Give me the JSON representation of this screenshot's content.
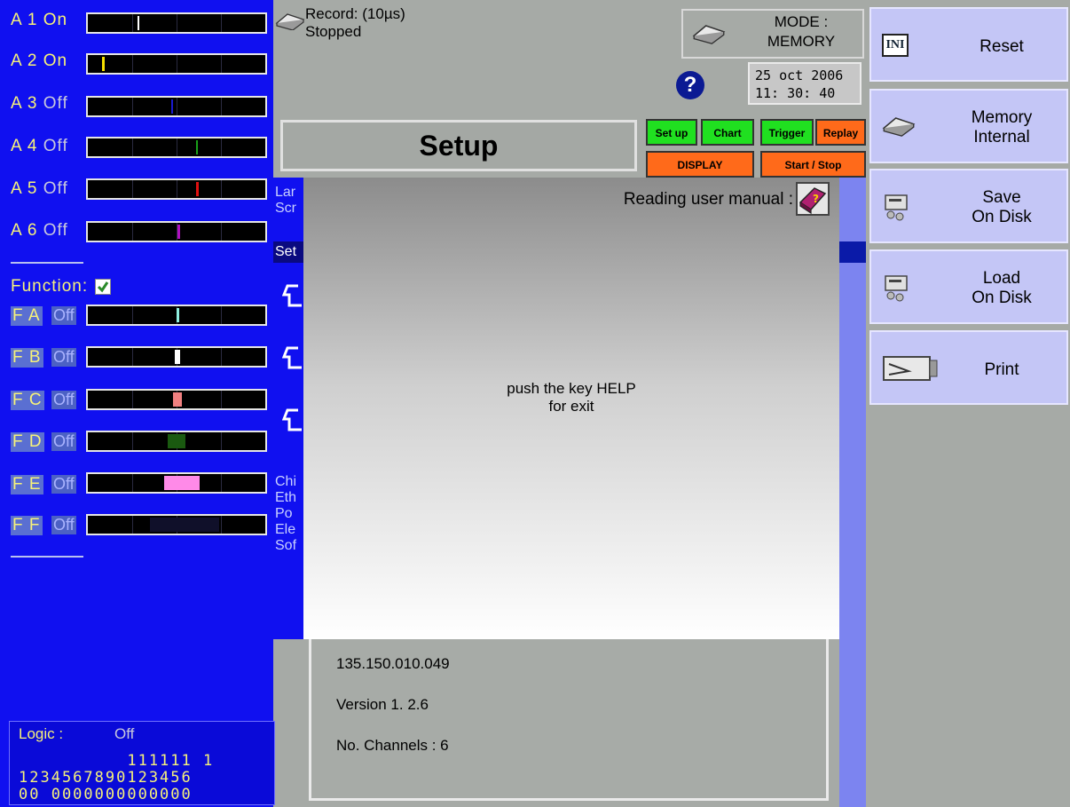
{
  "colors": {
    "left_panel_bg": "#1010f0",
    "label_yellow": "#f7f27a",
    "tab_green": "#20e020",
    "tab_orange": "#ff6a1a",
    "side_button_bg": "#c4c6f6",
    "help_badge": "#0b1a93"
  },
  "analog_channels": [
    {
      "name": "A 1",
      "state": "On",
      "marker_color": "#ffffff"
    },
    {
      "name": "A 2",
      "state": "On",
      "marker_color": "#f7e000"
    },
    {
      "name": "A 3",
      "state": "Off",
      "marker_color": "#1a1ad0"
    },
    {
      "name": "A 4",
      "state": "Off",
      "marker_color": "#19a019"
    },
    {
      "name": "A 5",
      "state": "Off",
      "marker_color": "#e01010"
    },
    {
      "name": "A 6",
      "state": "Off",
      "marker_color": "#b010c0"
    }
  ],
  "function_section": {
    "label": "Function:",
    "checked": true
  },
  "function_channels": [
    {
      "name": "F A",
      "state": "Off",
      "marker_color": "#8ff0e0"
    },
    {
      "name": "F B",
      "state": "Off",
      "marker_color": "#ffffff"
    },
    {
      "name": "F C",
      "state": "Off",
      "marker_color": "#f08080"
    },
    {
      "name": "F D",
      "state": "Off",
      "marker_color": "#1a5a10"
    },
    {
      "name": "F E",
      "state": "Off",
      "marker_color": "#ff8ae8"
    },
    {
      "name": "F F",
      "state": "Off",
      "marker_color": "#10102a"
    }
  ],
  "logic": {
    "label": "Logic :",
    "state": "Off",
    "tens_row": "          111111 1",
    "units_row": "1234567890123456",
    "values_row": "00 0000000000000"
  },
  "status": {
    "record_line1": "Record: (10µs)",
    "record_line2": "Stopped",
    "mode_line1": "MODE :",
    "mode_line2": "MEMORY",
    "date": "25 oct 2006",
    "time": "11: 30: 40",
    "help_icon": "question-icon"
  },
  "setup": {
    "title": "Setup",
    "tabs": [
      "Set up",
      "Chart",
      "Trigger",
      "Replay"
    ],
    "display_button": "DISPLAY",
    "start_stop_button": "Start / Stop"
  },
  "behind_overlay": {
    "lines_top": [
      "Lar",
      "Scr"
    ],
    "selected": "Set",
    "lines_bottom": [
      "Chi",
      "Eth",
      "Po",
      "Ele",
      "Sof"
    ]
  },
  "help_overlay": {
    "manual_label": "Reading user manual :",
    "message_line1": "push the key HELP",
    "message_line2": "for exit"
  },
  "info_panel": {
    "serial": "135.150.010.049",
    "version": "Version 1. 2.6",
    "channels": "No. Channels : 6"
  },
  "side_buttons": [
    {
      "line1": "Reset",
      "line2": "",
      "icon": "ini-icon"
    },
    {
      "line1": "Memory",
      "line2": "Internal",
      "icon": "memory-chip-icon"
    },
    {
      "line1": "Save",
      "line2": "On Disk",
      "icon": "disk-save-icon"
    },
    {
      "line1": "Load",
      "line2": "On Disk",
      "icon": "disk-load-icon"
    },
    {
      "line1": "Print",
      "line2": "",
      "icon": "printer-icon"
    }
  ]
}
